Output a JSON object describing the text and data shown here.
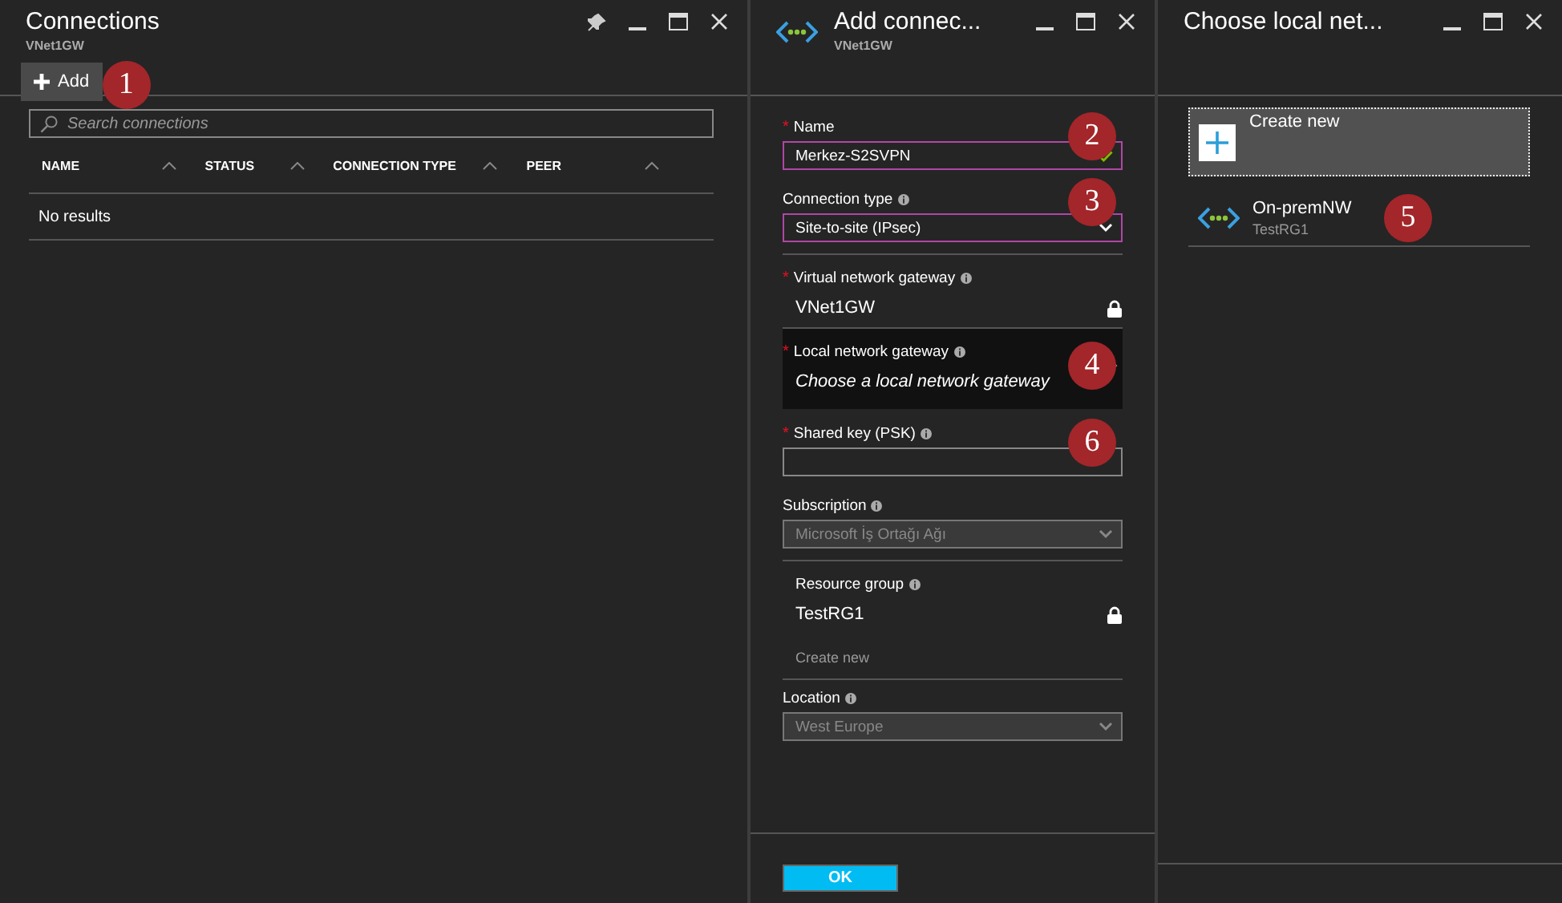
{
  "connections_blade": {
    "title": "Connections",
    "subtitle": "VNet1GW",
    "add_button": {
      "label": "Add",
      "callout": "1"
    },
    "search": {
      "placeholder": "Search connections"
    },
    "columns": [
      "NAME",
      "STATUS",
      "CONNECTION TYPE",
      "PEER"
    ],
    "empty_message": "No results"
  },
  "add_blade": {
    "title": "Add connec...",
    "subtitle": "VNet1GW",
    "fields": [
      {
        "kind": "text",
        "required_mark": "*",
        "label": "Name",
        "value": "Merkez-S2SVPN",
        "valid": true,
        "callout": "2"
      },
      {
        "kind": "dropdown",
        "label": "Connection type",
        "info": true,
        "value": "Site-to-site (IPsec)",
        "disabled": false,
        "callout": "3"
      },
      {
        "kind": "locked",
        "required_mark": "*",
        "label": "Virtual network gateway",
        "info": true,
        "value": "VNet1GW"
      },
      {
        "kind": "picker",
        "required_mark": "*",
        "label": "Local network gateway",
        "info": true,
        "value": "Choose a local network gateway",
        "callout": "4"
      },
      {
        "kind": "text",
        "required_mark": "*",
        "label": "Shared key (PSK)",
        "info": true,
        "valid": false,
        "callout": "6"
      },
      {
        "kind": "dropdown",
        "label": "Subscription",
        "info": true,
        "value": "Microsoft İş Ortağı Ağı",
        "disabled": true
      },
      {
        "kind": "locked",
        "label": "Resource group",
        "info": true,
        "value": "TestRG1",
        "link": "Create new"
      },
      {
        "kind": "dropdown",
        "label": "Location",
        "info": true,
        "value": "West Europe",
        "disabled": true
      }
    ],
    "ok_button": "OK"
  },
  "choose_blade": {
    "title": "Choose local net...",
    "items": [
      {
        "kind": "create",
        "label": "Create new",
        "selected": true
      },
      {
        "kind": "gateway",
        "label": "On-premNW",
        "subtitle": "TestRG1",
        "selected": false,
        "callout": "5"
      }
    ]
  }
}
